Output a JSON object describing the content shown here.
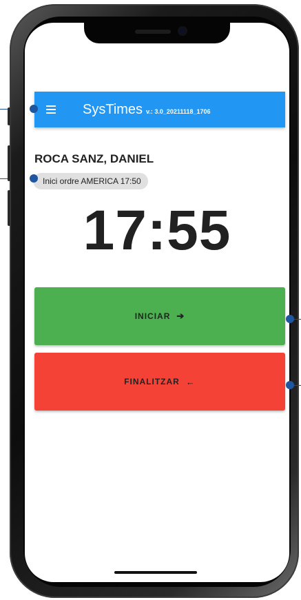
{
  "app": {
    "title": "SysTimes",
    "version": "v.: 3.0_20211118_1706"
  },
  "worker": {
    "name": "ROCA SANZ, DANIEL",
    "status_chip": "Inici ordre AMERICA 17:50"
  },
  "clock": {
    "time": "17:55"
  },
  "actions": {
    "start_label": "INICIAR",
    "start_arrow": "➔",
    "end_label": "FINALITZAR",
    "end_arrow": "←"
  },
  "icons": {
    "menu": "menu-icon",
    "start": "arrow-right-icon",
    "end": "arrow-left-icon"
  },
  "colors": {
    "appbar": "#2196f3",
    "start_button": "#4caf50",
    "end_button": "#f44336",
    "callout": "#1e56a0"
  }
}
